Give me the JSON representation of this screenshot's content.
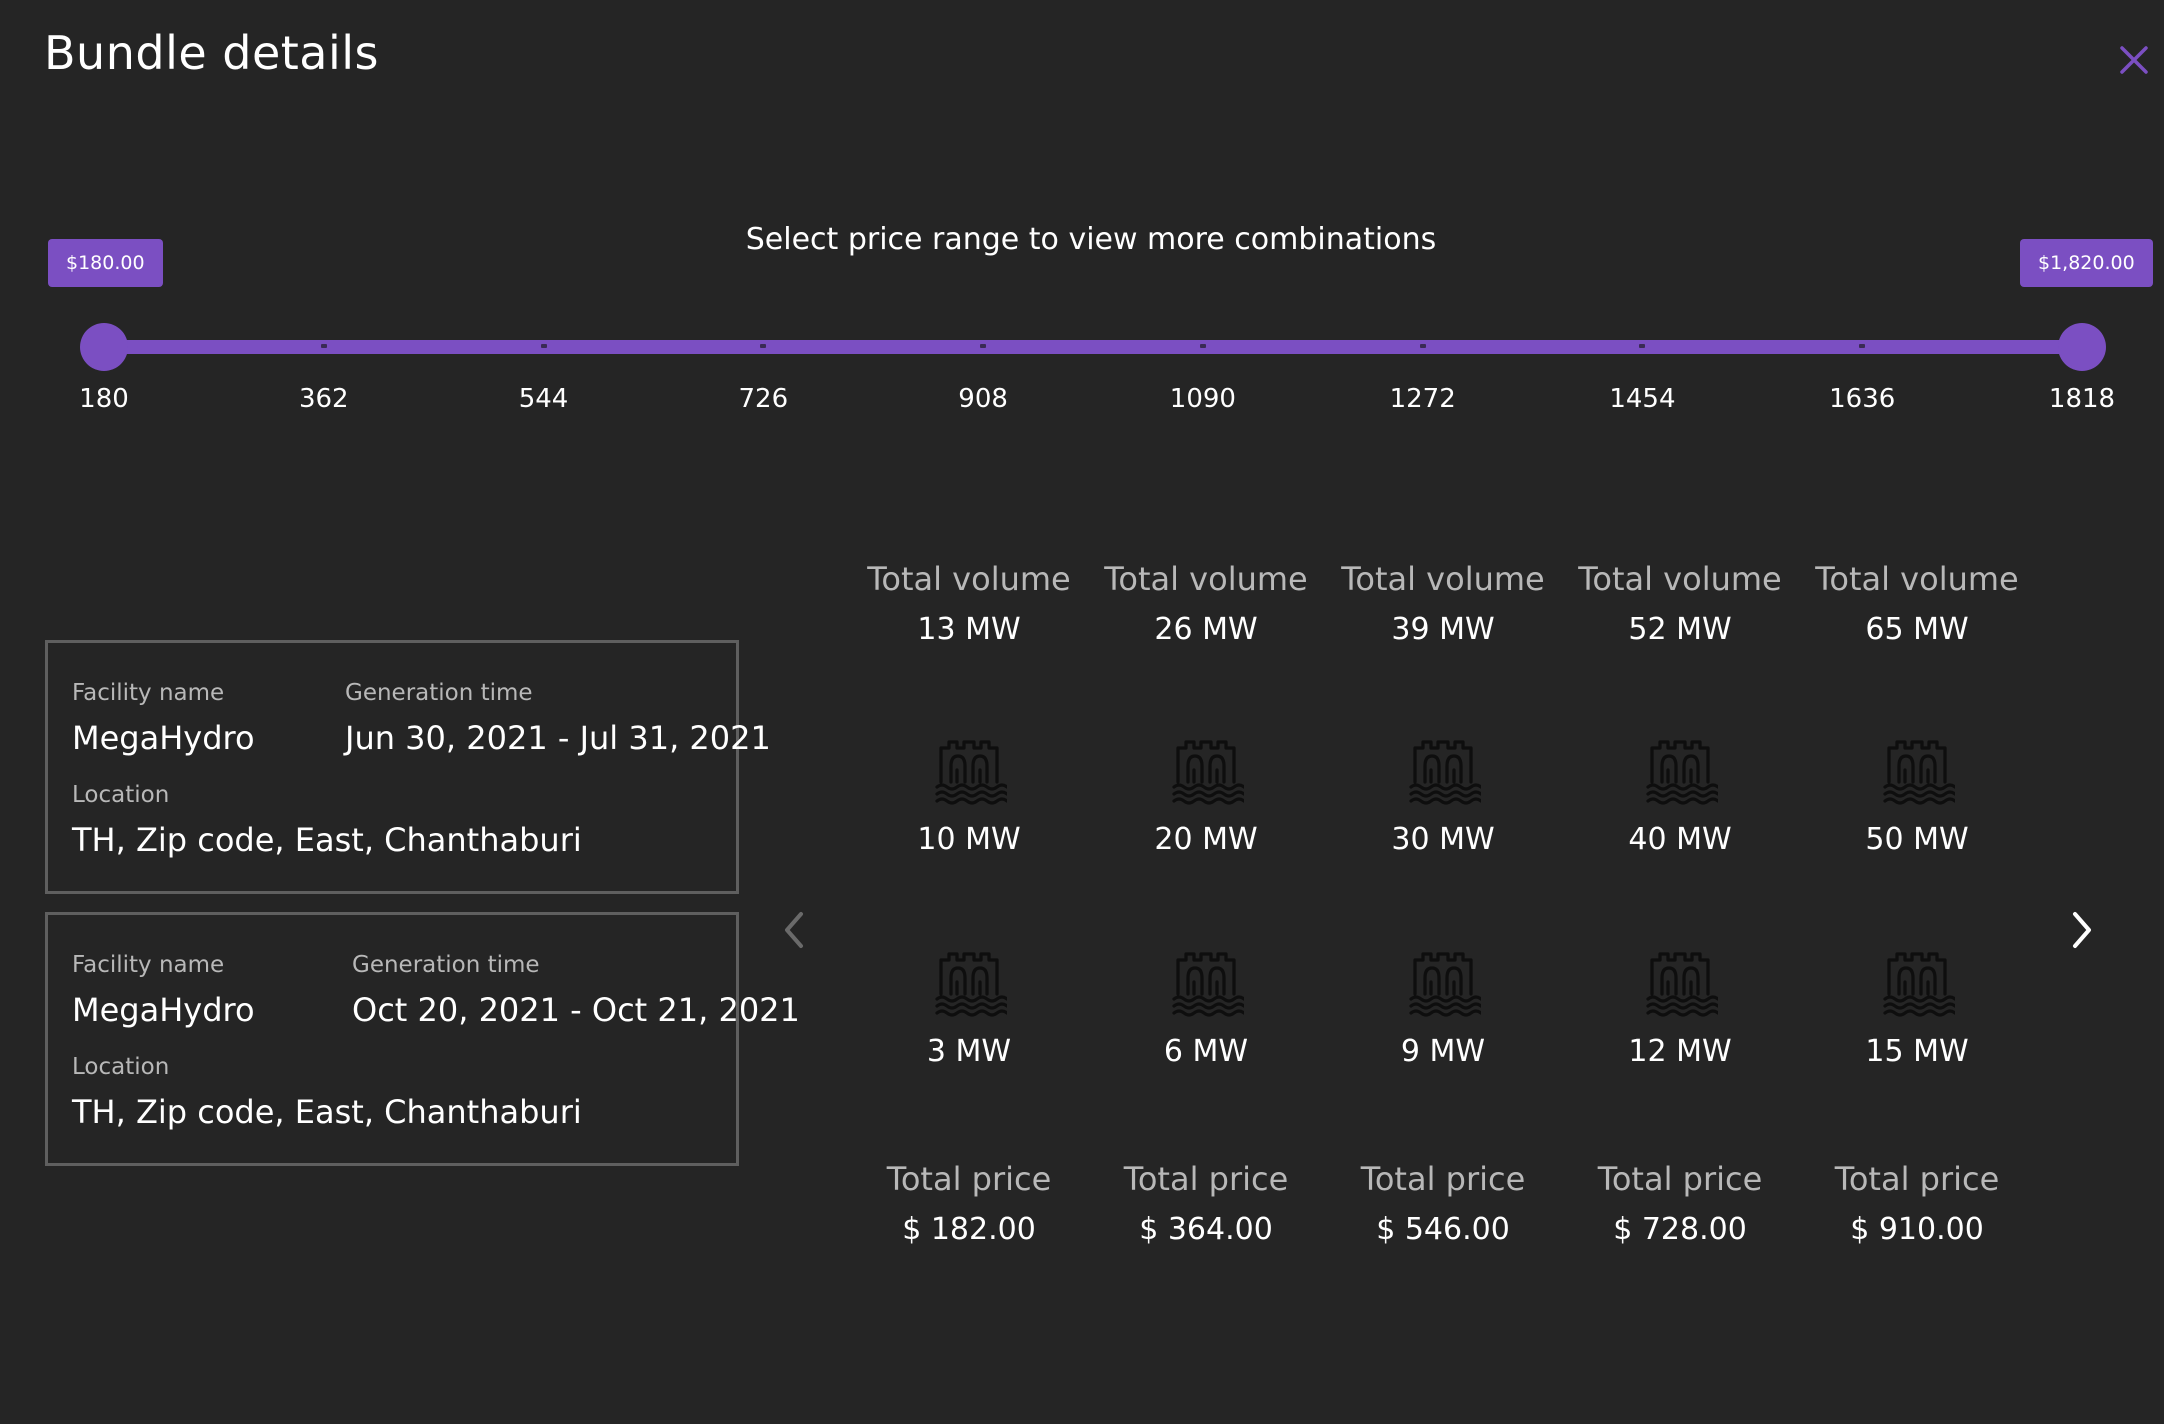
{
  "dialog": {
    "title": "Bundle details",
    "close_icon": "close-icon"
  },
  "slider": {
    "prompt": "Select price range to view more combinations",
    "min_label": "$180.00",
    "max_label": "$1,820.00",
    "selected_min": 180,
    "selected_max": 1820,
    "ticks": [
      "180",
      "362",
      "544",
      "726",
      "908",
      "1090",
      "1272",
      "1454",
      "1636",
      "1818"
    ],
    "accent_color": "#7b4fc2"
  },
  "facilities": [
    {
      "facility_name_label": "Facility name",
      "facility_name": "MegaHydro",
      "generation_time_label": "Generation time",
      "generation_time": "Jun 30, 2021 - Jul 31, 2021",
      "location_label": "Location",
      "location": "TH, Zip code, East, Chanthaburi"
    },
    {
      "facility_name_label": "Facility name",
      "facility_name": "MegaHydro",
      "generation_time_label": "Generation time",
      "generation_time": "Oct 20, 2021 - Oct 21, 2021",
      "location_label": "Location",
      "location": "TH, Zip code, East, Chanthaburi"
    }
  ],
  "combinations": [
    {
      "volume_label": "Total volume",
      "total_volume": "13 MW",
      "row1": "10 MW",
      "row2": "3 MW",
      "price_label": "Total price",
      "total_price": "$ 182.00"
    },
    {
      "volume_label": "Total volume",
      "total_volume": "26 MW",
      "row1": "20 MW",
      "row2": "6 MW",
      "price_label": "Total price",
      "total_price": "$ 364.00"
    },
    {
      "volume_label": "Total volume",
      "total_volume": "39 MW",
      "row1": "30 MW",
      "row2": "9 MW",
      "price_label": "Total price",
      "total_price": "$ 546.00"
    },
    {
      "volume_label": "Total volume",
      "total_volume": "52 MW",
      "row1": "40 MW",
      "row2": "12 MW",
      "price_label": "Total price",
      "total_price": "$ 728.00"
    },
    {
      "volume_label": "Total volume",
      "total_volume": "65 MW",
      "row1": "50 MW",
      "row2": "15 MW",
      "price_label": "Total price",
      "total_price": "$ 910.00"
    }
  ],
  "icons": {
    "facility_icon": "hydro-dam-icon",
    "prev": "chevron-left-icon",
    "next": "chevron-right-icon"
  }
}
